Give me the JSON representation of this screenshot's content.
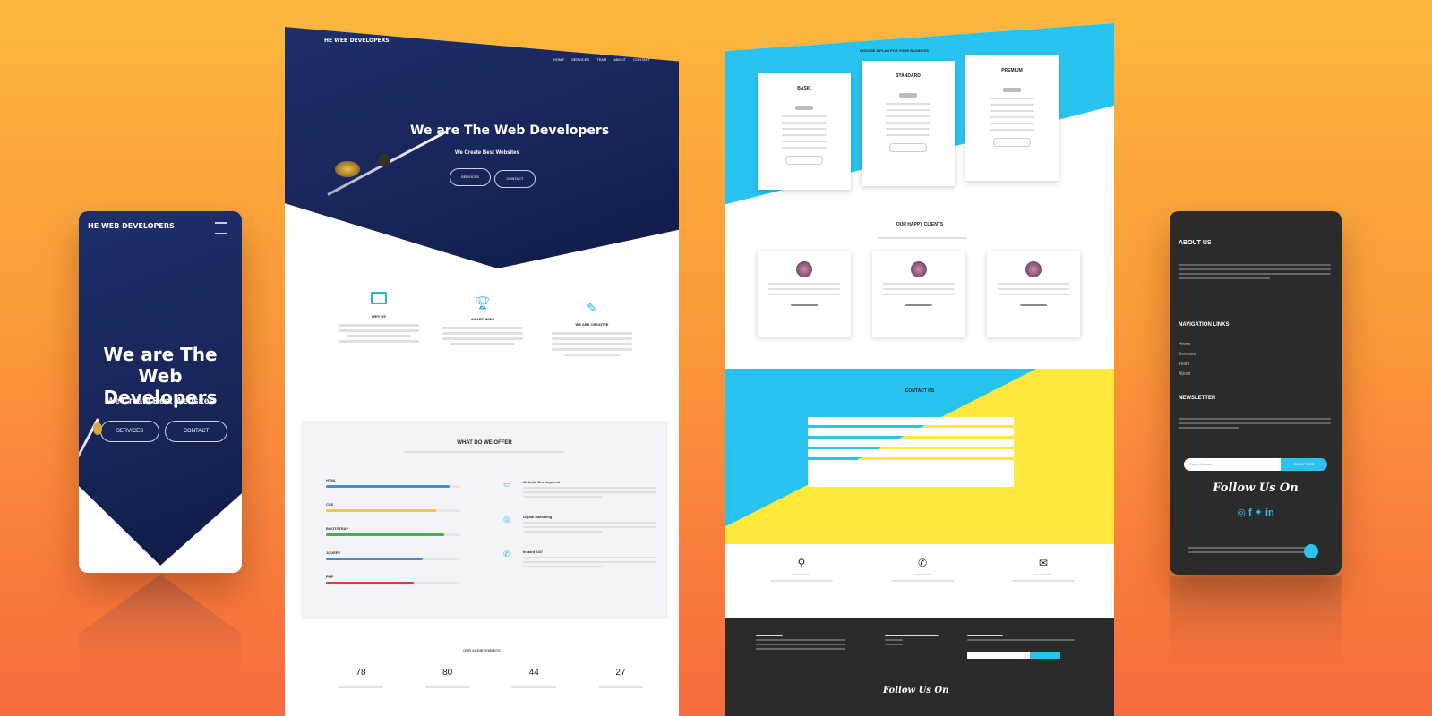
{
  "colors": {
    "navy": "#1a2a63",
    "cyan": "#29c3f0",
    "yellow": "#ffe83c",
    "dark": "#2b2b2b",
    "orange": "#fb9a3a"
  },
  "mobile_left": {
    "brand": "HE WEB DEVELOPERS",
    "menu_icon": "hamburger-icon",
    "hero_title": "We are The Web Developers",
    "hero_subtitle": "We Create Best Websites",
    "btn_primary": "SERVICES",
    "btn_secondary": "CONTACT"
  },
  "desktop_left": {
    "brand": "HE WEB DEVELOPERS",
    "nav": [
      "HOME",
      "SERVICES",
      "TEAM",
      "ABOUT",
      "CONTACT"
    ],
    "hero_title": "We are The Web Developers",
    "hero_subtitle": "We Create Best Websites",
    "btn_primary": "SERVICES",
    "btn_secondary": "CONTACT",
    "features": [
      {
        "icon": "monitor-icon",
        "title": "WHY US"
      },
      {
        "icon": "trophy-icon",
        "title": "AWARD WINS"
      },
      {
        "icon": "pencil-icon",
        "title": "WE ARE CREATIVE"
      }
    ],
    "offer_title": "WHAT DO WE OFFER",
    "skills": [
      {
        "name": "HTML",
        "level": 0.92,
        "color": "#3c8fe0"
      },
      {
        "name": "CSS",
        "level": 0.82,
        "color": "#f0c83a"
      },
      {
        "name": "BOOTSTRAP",
        "level": 0.88,
        "color": "#3cb54a"
      },
      {
        "name": "JQUERY",
        "level": 0.72,
        "color": "#3c8fe0"
      },
      {
        "name": "PHP",
        "level": 0.65,
        "color": "#e03c3c"
      }
    ],
    "services": [
      {
        "icon": "monitor-icon",
        "title": "Website Development"
      },
      {
        "icon": "target-icon",
        "title": "Digital Marketing"
      },
      {
        "icon": "phone-icon",
        "title": "Instant 24/7"
      }
    ],
    "stats_title": "OUR ACHIEVEMENTS",
    "stats": [
      "78",
      "80",
      "44",
      "27"
    ]
  },
  "desktop_right": {
    "pricing_title": "CHOOSE A PLAN FOR YOUR BUSINESS",
    "plans": [
      {
        "name": "BASIC"
      },
      {
        "name": "STANDARD"
      },
      {
        "name": "PREMIUM"
      }
    ],
    "clients_title": "OUR HAPPY CLIENTS",
    "contact_title": "CONTACT US",
    "contact_items": [
      {
        "icon": "location-icon"
      },
      {
        "icon": "phone-icon"
      },
      {
        "icon": "mail-icon"
      }
    ],
    "footer_follow": "Follow Us On"
  },
  "mobile_right": {
    "about_title": "ABOUT US",
    "nav_title": "NAVIGATION LINKS",
    "nav_links": [
      "Home",
      "Services",
      "Team",
      "About"
    ],
    "newsletter_title": "NEWSLETTER",
    "email_placeholder": "Email Address",
    "subscribe": "SUBSCRIBE",
    "follow": "Follow Us On",
    "social_icons": [
      "instagram-icon",
      "facebook-icon",
      "twitter-icon",
      "linkedin-icon"
    ]
  }
}
